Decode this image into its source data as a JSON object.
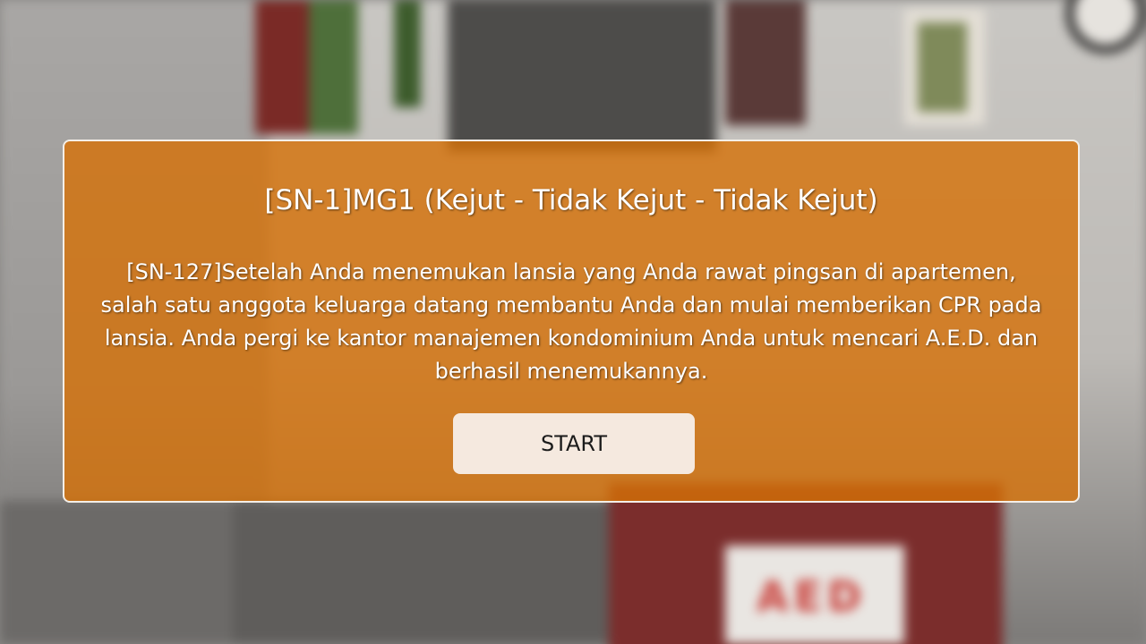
{
  "dialog": {
    "title": "[SN-1]MG1 (Kejut - Tidak Kejut - Tidak Kejut)",
    "body": "[SN-127]Setelah Anda menemukan lansia yang Anda rawat pingsan di apartemen, salah satu anggota keluarga datang membantu Anda dan mulai memberikan CPR pada lansia. Anda pergi ke kantor manajemen kondominium Anda untuk mencari A.E.D. dan berhasil menemukannya.",
    "start_label": "START"
  },
  "background": {
    "aed_label": "AED"
  },
  "colors": {
    "dialog_bg": "#d67006",
    "dialog_border": "#f4efe8",
    "button_bg": "#f5e9df",
    "text": "#ffffff"
  }
}
